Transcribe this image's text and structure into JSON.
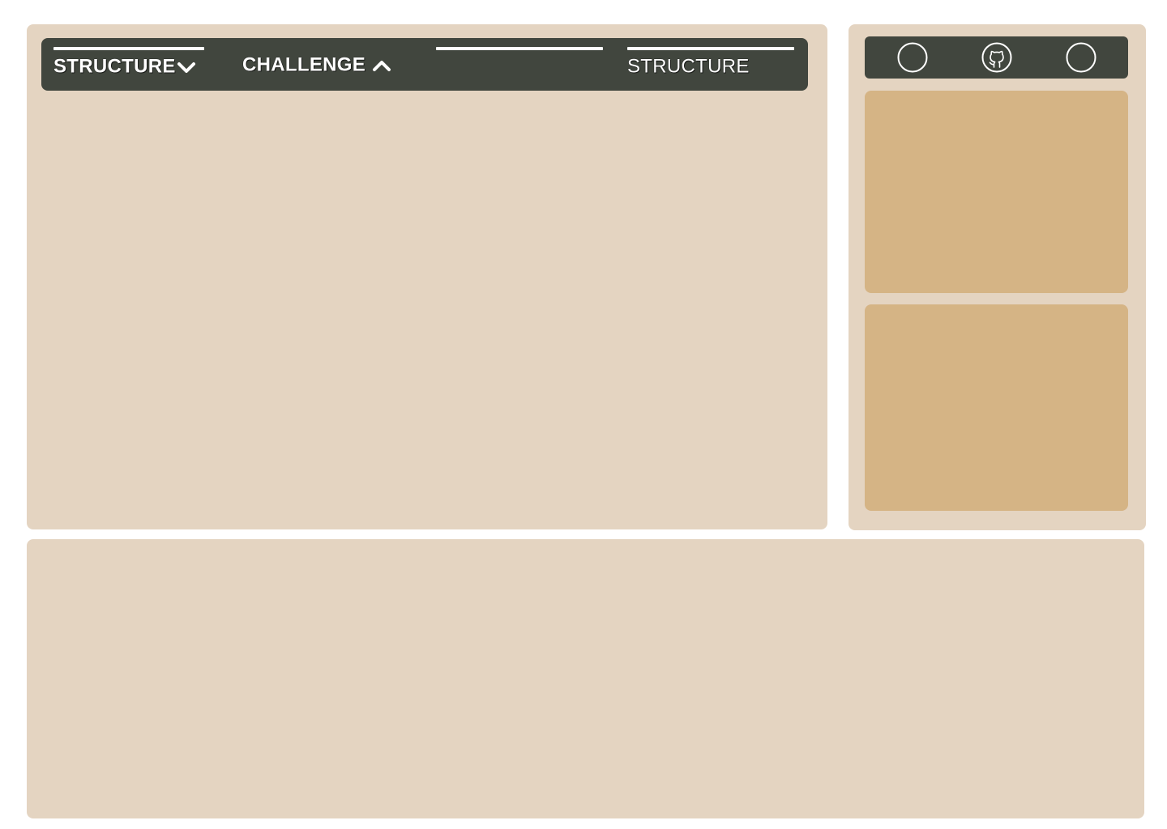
{
  "nav": {
    "items": [
      {
        "label": "STRUCTURE",
        "icon": "chevron-down-icon",
        "active": true
      },
      {
        "label": "CHALLENGE",
        "icon": "chevron-up-icon",
        "active": false
      },
      {
        "label": "",
        "active": true
      },
      {
        "label": "STRUCTURE",
        "active": true
      }
    ]
  },
  "side": {
    "icons": [
      "circle-icon",
      "github-icon",
      "circle-icon"
    ]
  },
  "colors": {
    "panel_bg": "#e4d4c1",
    "nav_bg": "#41463e",
    "card_bg": "#d5b485",
    "accent": "#ffffff"
  }
}
